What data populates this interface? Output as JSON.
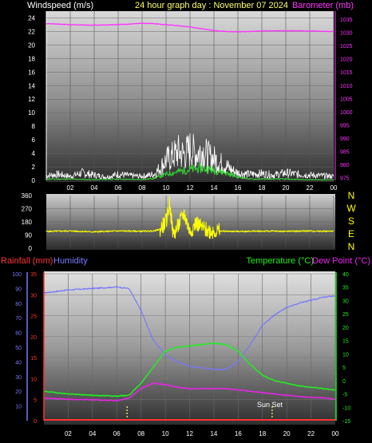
{
  "header": {
    "windspeed_label": "Windspeed (m/s)",
    "title": "24 hour graph day : November 07 2024",
    "barometer_label": "Barometer (mb)"
  },
  "lower_header": {
    "rainfall_label": "Rainfall (mm)",
    "humidity_label": "Humidity",
    "temperature_label": "Temperature (°C)",
    "dewpoint_label": "Dew Point (°C)"
  },
  "annotations": {
    "sunset": "Sun Set"
  },
  "colors": {
    "windspeed_axis": "#ffffff",
    "barometer": "#ff33ff",
    "wind_gust": "#ffffff",
    "wind_avg": "#33dd33",
    "wind_dir": "#ffff00",
    "rainfall": "#ff3333",
    "humidity": "#7777ff",
    "temperature": "#22ee22",
    "dewpoint": "#ee22ee",
    "marker": "#ffff66"
  },
  "chart_data": [
    {
      "type": "line",
      "id": "wind-baro",
      "x_ticks": [
        "02",
        "04",
        "06",
        "08",
        "10",
        "12",
        "14",
        "16",
        "18",
        "20",
        "22",
        "00"
      ],
      "y_left_ticks": [
        "0",
        "2",
        "4",
        "6",
        "8",
        "10",
        "12",
        "14",
        "16",
        "18",
        "20",
        "22",
        "24"
      ],
      "y_right_ticks": [
        "975",
        "980",
        "985",
        "990",
        "995",
        "1000",
        "1005",
        "1010",
        "1015",
        "1020",
        "1025",
        "1030",
        "1035"
      ],
      "ylim_left": [
        0,
        25
      ],
      "ylim_right": [
        974,
        1038
      ],
      "series": [
        {
          "name": "Barometer (mb)",
          "axis": "right",
          "x": [
            0,
            2,
            4,
            6,
            8,
            9,
            10,
            11,
            12,
            13,
            14,
            15,
            16,
            17,
            18,
            19,
            20,
            21,
            22,
            23,
            24
          ],
          "values": [
            1033.3,
            1032.9,
            1032.7,
            1032.9,
            1033.4,
            1033.3,
            1032.9,
            1032.5,
            1032.0,
            1031.4,
            1030.7,
            1030.3,
            1030.2,
            1030.3,
            1030.5,
            1030.6,
            1030.6,
            1030.6,
            1030.5,
            1030.4,
            1030.3
          ]
        },
        {
          "name": "Windspeed (m/s)",
          "axis": "left",
          "x": [
            0,
            1,
            2,
            3,
            4,
            5,
            6,
            7,
            8,
            9,
            9.5,
            10,
            10.5,
            11,
            11.5,
            12,
            12.5,
            13,
            13.5,
            14,
            14.5,
            15,
            15.5,
            16,
            17,
            18,
            19,
            20,
            21,
            22,
            23,
            24
          ],
          "values": [
            0.7,
            0.9,
            0.6,
            1.1,
            0.8,
            0.5,
            0.9,
            0.7,
            0.6,
            0.9,
            1.8,
            3.0,
            3.5,
            4.2,
            3.8,
            4.6,
            3.9,
            4.4,
            3.6,
            3.2,
            2.6,
            2.2,
            1.5,
            1.1,
            0.9,
            1.0,
            0.8,
            1.1,
            0.9,
            0.8,
            0.7,
            0.6
          ]
        },
        {
          "name": "Average windspeed",
          "axis": "left",
          "x": [
            0,
            2,
            4,
            6,
            8,
            9,
            10,
            11,
            12,
            13,
            14,
            15,
            16,
            17,
            18,
            20,
            22,
            24
          ],
          "values": [
            0.2,
            0.2,
            0.1,
            0.2,
            0.1,
            0.3,
            0.9,
            1.3,
            1.6,
            1.8,
            1.5,
            1.1,
            0.5,
            0.2,
            0.2,
            0.2,
            0.1,
            0.1
          ]
        }
      ]
    },
    {
      "type": "line",
      "id": "wind-direction",
      "y_ticks": [
        "360",
        "270",
        "180",
        "90",
        "0"
      ],
      "ylim": [
        0,
        360
      ],
      "compass_labels": [
        "N",
        "W",
        "S",
        "E",
        "N"
      ],
      "series": [
        {
          "name": "Wind direction",
          "x": [
            0,
            2,
            4,
            6,
            8,
            9,
            9.5,
            10,
            10.3,
            10.6,
            11,
            11.5,
            12,
            12.5,
            13,
            13.5,
            14,
            15,
            16,
            18,
            20,
            22,
            24
          ],
          "values": [
            115,
            118,
            112,
            118,
            116,
            118,
            130,
            180,
            310,
            90,
            150,
            240,
            110,
            175,
            140,
            120,
            118,
            116,
            115,
            117,
            116,
            118,
            116
          ]
        }
      ]
    },
    {
      "type": "line",
      "id": "temp-humidity-rain",
      "x_ticks": [
        "02",
        "04",
        "06",
        "08",
        "10",
        "12",
        "14",
        "16",
        "18",
        "20",
        "22",
        "00"
      ],
      "y_left_ticks": [
        "0",
        "5",
        "10",
        "15",
        "20",
        "25",
        "30",
        "35"
      ],
      "y_humidity_ticks": [
        "10",
        "20",
        "30",
        "40",
        "50",
        "60",
        "70",
        "80",
        "90",
        "100"
      ],
      "y_right_ticks": [
        "-15",
        "-10",
        "-5",
        "0",
        "5",
        "10",
        "15",
        "20",
        "25",
        "30",
        "35",
        "40"
      ],
      "ylim_left": [
        0,
        35
      ],
      "ylim_humidity": [
        0,
        100
      ],
      "ylim_right": [
        -15,
        40
      ],
      "series": [
        {
          "name": "Humidity",
          "axis": "humidity",
          "x": [
            0,
            2,
            4,
            6,
            7,
            8,
            9,
            10,
            11,
            12,
            13,
            14,
            15,
            16,
            17,
            18,
            19,
            20,
            21,
            22,
            23,
            24
          ],
          "values": [
            87,
            89,
            90,
            91,
            90,
            75,
            55,
            45,
            40,
            37,
            36,
            35,
            35,
            40,
            52,
            65,
            72,
            77,
            80,
            82,
            84,
            85
          ]
        },
        {
          "name": "Temperature (°C)",
          "axis": "right",
          "x": [
            0,
            2,
            4,
            6,
            7,
            8,
            9,
            10,
            11,
            12,
            13,
            14,
            15,
            16,
            17,
            18,
            19,
            20,
            21,
            22,
            23,
            24
          ],
          "values": [
            -4,
            -5,
            -5.5,
            -5.8,
            -5.5,
            -1,
            5,
            11,
            12.5,
            13,
            13.5,
            14,
            13.5,
            11,
            6,
            2,
            0,
            -1,
            -2,
            -2.5,
            -3,
            -3.5
          ]
        },
        {
          "name": "Dew Point (°C)",
          "axis": "right",
          "x": [
            0,
            2,
            4,
            6,
            7,
            8,
            9,
            10,
            11,
            12,
            13,
            14,
            15,
            16,
            17,
            18,
            19,
            20,
            21,
            22,
            23,
            24
          ],
          "values": [
            -6.5,
            -7,
            -7.2,
            -7.5,
            -6.5,
            -3,
            -1,
            -1.5,
            -2.5,
            -3,
            -3,
            -3,
            -3,
            -3.5,
            -4,
            -4.5,
            -5,
            -5.5,
            -6,
            -6.3,
            -6.5,
            -7
          ]
        },
        {
          "name": "Rainfall (mm)",
          "axis": "left",
          "x": [
            0,
            24
          ],
          "values": [
            0,
            0
          ]
        }
      ],
      "markers": [
        {
          "name": "Sunrise",
          "x": 6.85
        },
        {
          "name": "Sun Set",
          "x": 18.8
        }
      ]
    }
  ]
}
